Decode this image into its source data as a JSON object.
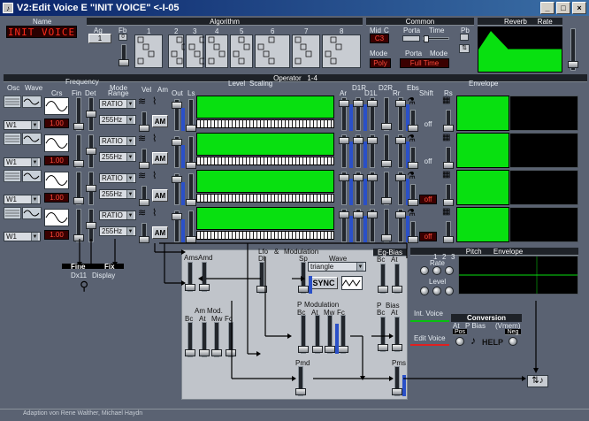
{
  "window": {
    "title": "V2:Edit Voice E \"INIT VOICE\" <-I-05",
    "min": "_",
    "max": "□",
    "close": "×"
  },
  "voice": {
    "name_label": "Name",
    "name": "INIT VOICE"
  },
  "algorithm": {
    "header": "Algorithm",
    "ag_label": "Ag",
    "ag_value": "1",
    "fb_label": "Fb",
    "fb_value": "0",
    "slots": [
      "1",
      "2",
      "3",
      "4",
      "5",
      "6",
      "7",
      "8"
    ]
  },
  "common": {
    "header": "Common",
    "mid_label": "Mid",
    "c_label": "C",
    "mid_value": "C3",
    "porta_label": "Porta",
    "time_label": "Time",
    "pb_label": "Pb",
    "mode_label": "Mode",
    "mode_value": "Poly",
    "porta_mode_label": "Porta",
    "porta_mode_label2": "Mode",
    "porta_mode_value": "Full Time"
  },
  "reverb": {
    "header_reverb": "Reverb",
    "header_rate": "Rate"
  },
  "operator": {
    "header": "Operator",
    "header_range": "1-4",
    "col_osc": "Osc",
    "col_wave": "Wave",
    "col_frequency": "Frequency",
    "col_crs": "Crs",
    "col_fin": "Fin",
    "col_det": "Det",
    "col_mode": "Mode",
    "col_range": "Range",
    "col_vel": "Vel",
    "col_am": "Am",
    "col_out": "Out",
    "col_ls": "Ls",
    "col_level": "Level",
    "col_scaling": "Scaling",
    "col_ar": "Ar",
    "col_d1r": "D1R",
    "col_d1l": "D1L",
    "col_d2r": "D2R",
    "col_rr": "Rr",
    "col_ebs": "Ebs",
    "col_shift": "Shift",
    "col_rs": "Rs",
    "col_envelope": "Envelope",
    "rows": [
      {
        "wave": "W1",
        "crs": "1.00",
        "mode": "RATIO",
        "range": "255Hz",
        "am": "AM",
        "shift": "off"
      },
      {
        "wave": "W1",
        "crs": "1.00",
        "mode": "RATIO",
        "range": "255Hz",
        "am": "AM",
        "shift": "off"
      },
      {
        "wave": "W1",
        "crs": "1.00",
        "mode": "RATIO",
        "range": "255Hz",
        "am": "AM",
        "shift": "off"
      },
      {
        "wave": "W1",
        "crs": "1.00",
        "mode": "RATIO",
        "range": "255Hz",
        "am": "AM",
        "shift": "off"
      }
    ]
  },
  "fine_fix": {
    "fine": "Fine",
    "fix": "Fix",
    "dx11": "Dx11",
    "display": "Display"
  },
  "lfo": {
    "ams": "Ams",
    "amd": "Amd",
    "lfo": "Lfo",
    "amp": "&",
    "modulation": "Modulation",
    "dl": "Dl",
    "sp": "Sp",
    "wave": "Wave",
    "wave_value": "triangle",
    "sync": "SYNC",
    "am_mod": "Am",
    "mod": "Mod.",
    "bc": "Bc",
    "at": "At",
    "mw": "Mw",
    "fc": "Fc",
    "p_mod": "P",
    "p_modulation": "Modulation",
    "pmd": "Pmd",
    "pms": "Pms"
  },
  "egbias": {
    "header": "Eg-Bias",
    "bc": "Bc",
    "at": "At",
    "p": "P",
    "bias": "Bias"
  },
  "pitch_env": {
    "header": "Pitch",
    "header2": "Envelope",
    "rate": "Rate",
    "level": "Level",
    "n1": "1",
    "n2": "2",
    "n3": "3"
  },
  "conversion": {
    "int_voice": "Int. Voice",
    "edit_voice": "Edit Voice",
    "header": "Conversion",
    "at": "At",
    "pbias": "P Bias",
    "vmem": "(Vmem)",
    "pos": "Pos",
    "neg": "Neg",
    "help": "HELP"
  },
  "status": {
    "credits": "Adaption von Rene Walther, Michael Haydn"
  }
}
